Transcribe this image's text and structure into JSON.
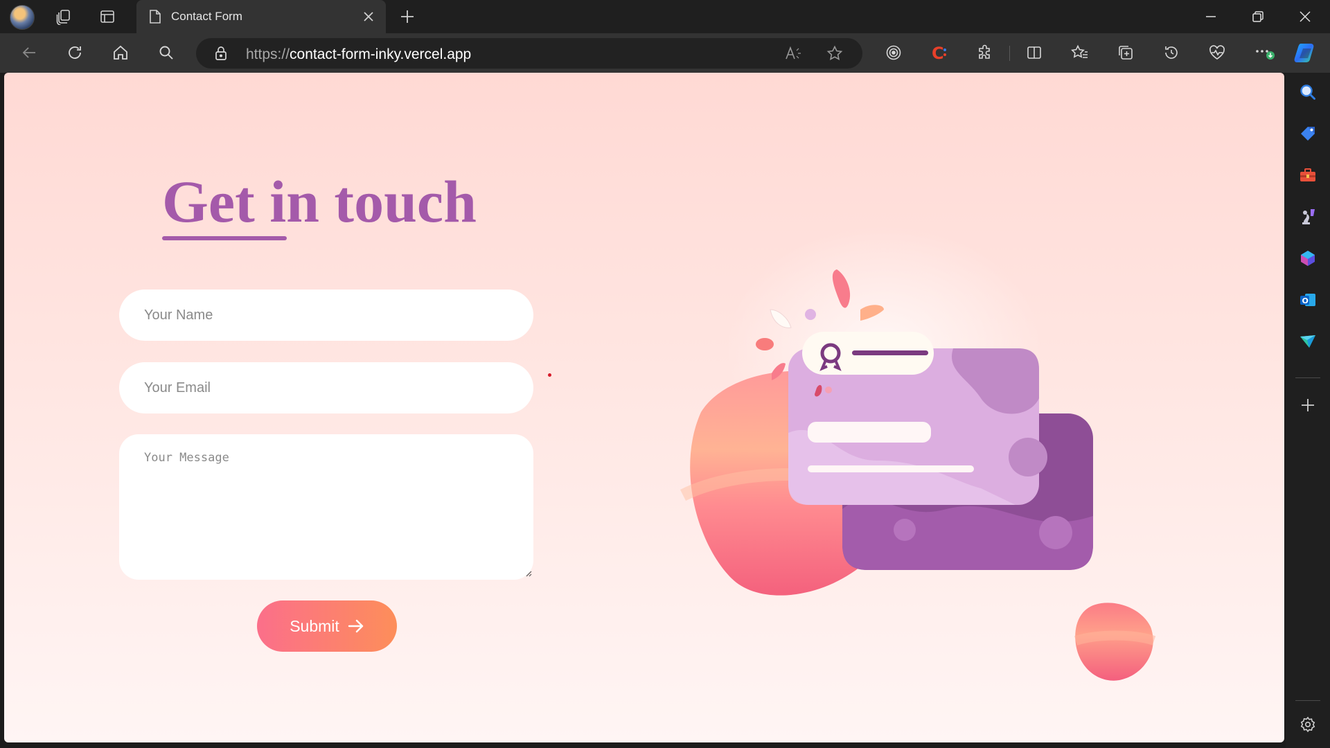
{
  "browser": {
    "tab": {
      "title": "Contact Form"
    },
    "address": {
      "protocol": "https://",
      "host": "contact-form-inky.vercel.app"
    }
  },
  "form": {
    "heading": "Get in touch",
    "name_placeholder": "Your Name",
    "email_placeholder": "Your Email",
    "message_placeholder": "Your Message",
    "submit_label": "Submit",
    "submit_icon": "arrow-right-icon"
  },
  "colors": {
    "heading": "#a45aaa",
    "page_gradient_top": "#ffd9d4",
    "page_gradient_bottom": "#fff5f4",
    "submit_gradient_start": "#fb6f8a",
    "submit_gradient_end": "#fd8e5a",
    "browser_chrome": "#1f1f1f"
  },
  "icons": {
    "titlebar": [
      "profile-avatar",
      "workspaces-icon",
      "tab-actions-icon",
      "page-icon",
      "close-icon",
      "new-tab-icon",
      "minimize-icon",
      "restore-icon",
      "close-window-icon"
    ],
    "toolbar": [
      "back-icon",
      "refresh-icon",
      "home-icon",
      "search-icon",
      "lock-icon",
      "read-aloud-icon",
      "favorite-star-icon",
      "extension-target-icon",
      "extension-c-icon",
      "extensions-icon",
      "split-screen-icon",
      "favorites-icon",
      "collections-icon",
      "history-icon",
      "browser-essentials-icon",
      "more-icon",
      "copilot-icon"
    ],
    "sidebar": [
      "search-icon",
      "shopping-tag-icon",
      "tools-icon",
      "games-icon",
      "copilot-apps-icon",
      "outlook-icon",
      "drop-icon",
      "add-icon",
      "settings-icon"
    ]
  }
}
